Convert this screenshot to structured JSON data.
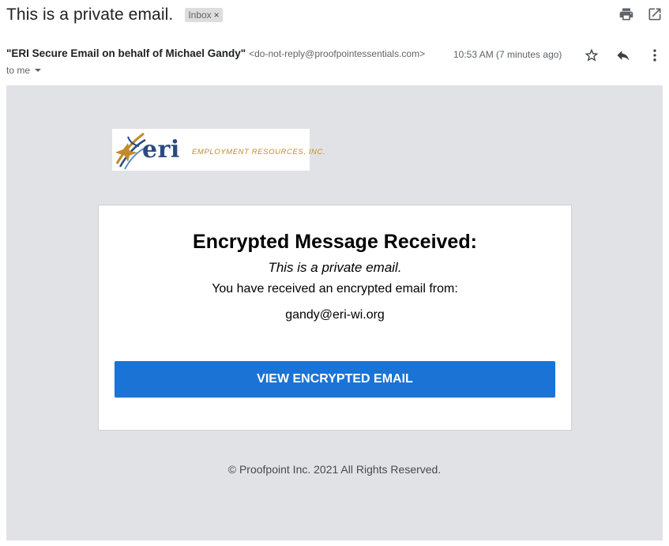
{
  "subject": "This is a private email.",
  "label": {
    "text": "Inbox",
    "remove_glyph": "×"
  },
  "top_icons": [
    "print-icon",
    "open-in-new-window-icon"
  ],
  "sender": {
    "name": "\"ERI Secure Email on behalf of Michael Gandy\"",
    "email": "<do-not-reply@proofpointessentials.com>",
    "time": "10:53 AM (7 minutes ago)",
    "icons": [
      "star-icon",
      "reply-icon",
      "more-vert-icon"
    ]
  },
  "recipient": {
    "label": "to me"
  },
  "body": {
    "logo": {
      "wordmark": "eri",
      "tagline": "EMPLOYMENT RESOURCES, INC."
    },
    "card": {
      "title": "Encrypted Message Received:",
      "subtitle": "This is a private email.",
      "from_text": "You have received an encrypted email from:",
      "from_email": "gandy@eri-wi.org",
      "button_label": "VIEW ENCRYPTED EMAIL"
    },
    "footer": "© Proofpoint Inc. 2021 All Rights Reserved."
  },
  "colors": {
    "body_background": "#e1e2e6",
    "button_blue": "#1a73d5",
    "logo_navy": "#2b4a7f",
    "logo_gold": "#c28a2b"
  }
}
